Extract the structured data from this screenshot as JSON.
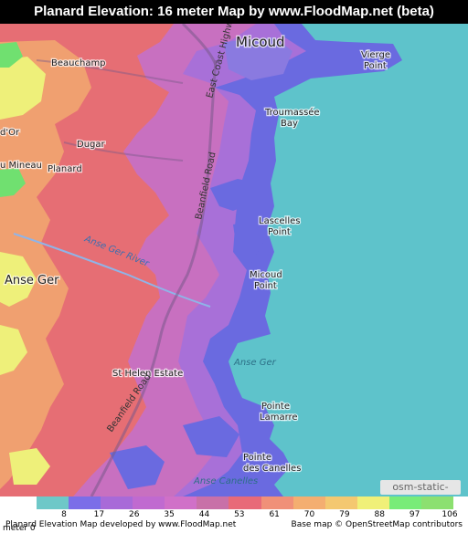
{
  "title": "Planard Elevation: 16 meter Map by www.FloodMap.net (beta)",
  "map": {
    "places": {
      "micoud": "Micoud",
      "vierge_point": [
        "Vierge",
        "Point"
      ],
      "beauchamp": "Beauchamp",
      "troumassee_bay": [
        "Troumassée",
        "Bay"
      ],
      "d_or": "d'Or",
      "dugar": "Dugar",
      "mineau": "u Mineau",
      "planard": "Planard",
      "lascelles_point": [
        "Lascelles",
        "Point"
      ],
      "anse_ger_town": "Anse Ger",
      "micoud_point": [
        "Micoud",
        "Point"
      ],
      "anse_ger_sea": "Anse Ger",
      "st_helen_estate": "St Helen Estate",
      "pointe_lamarre": [
        "Pointe",
        "Lamarre"
      ],
      "pointe_des_canelles": [
        "Pointe",
        "des Canelles"
      ],
      "anse_canelles": "Anse Canelles"
    },
    "roads": {
      "east_coast_highway": "East Coast Highway",
      "beanfield_road_north": "Beanfield Road",
      "beanfield_road_south": "Beanfield Road"
    },
    "river": "Anse Ger River",
    "attribution_badge": "osm-static-maps"
  },
  "legend": {
    "unit_label": "meter",
    "ticks": [
      "0",
      "8",
      "17",
      "26",
      "35",
      "44",
      "53",
      "61",
      "70",
      "79",
      "88",
      "97",
      "106"
    ],
    "colors": [
      "#6ec8c8",
      "#7b6ee8",
      "#a86ad8",
      "#c06ad0",
      "#d070c8",
      "#c870a8",
      "#e86a78",
      "#f09078",
      "#f4ae70",
      "#f4c870",
      "#f0f078",
      "#78ec78",
      "#8ce070"
    ]
  },
  "footer": {
    "left": "Planard Elevation Map developed by www.FloodMap.net",
    "right": "Base map © OpenStreetMap contributors"
  },
  "colors": {
    "sea": "#5ec3cb",
    "low_blue": "#6a6ae0",
    "violet": "#a870d8",
    "pink": "#c870c0",
    "salmon": "#e67070",
    "orange": "#f0a070",
    "yellow": "#eef07a",
    "green": "#70e070"
  }
}
